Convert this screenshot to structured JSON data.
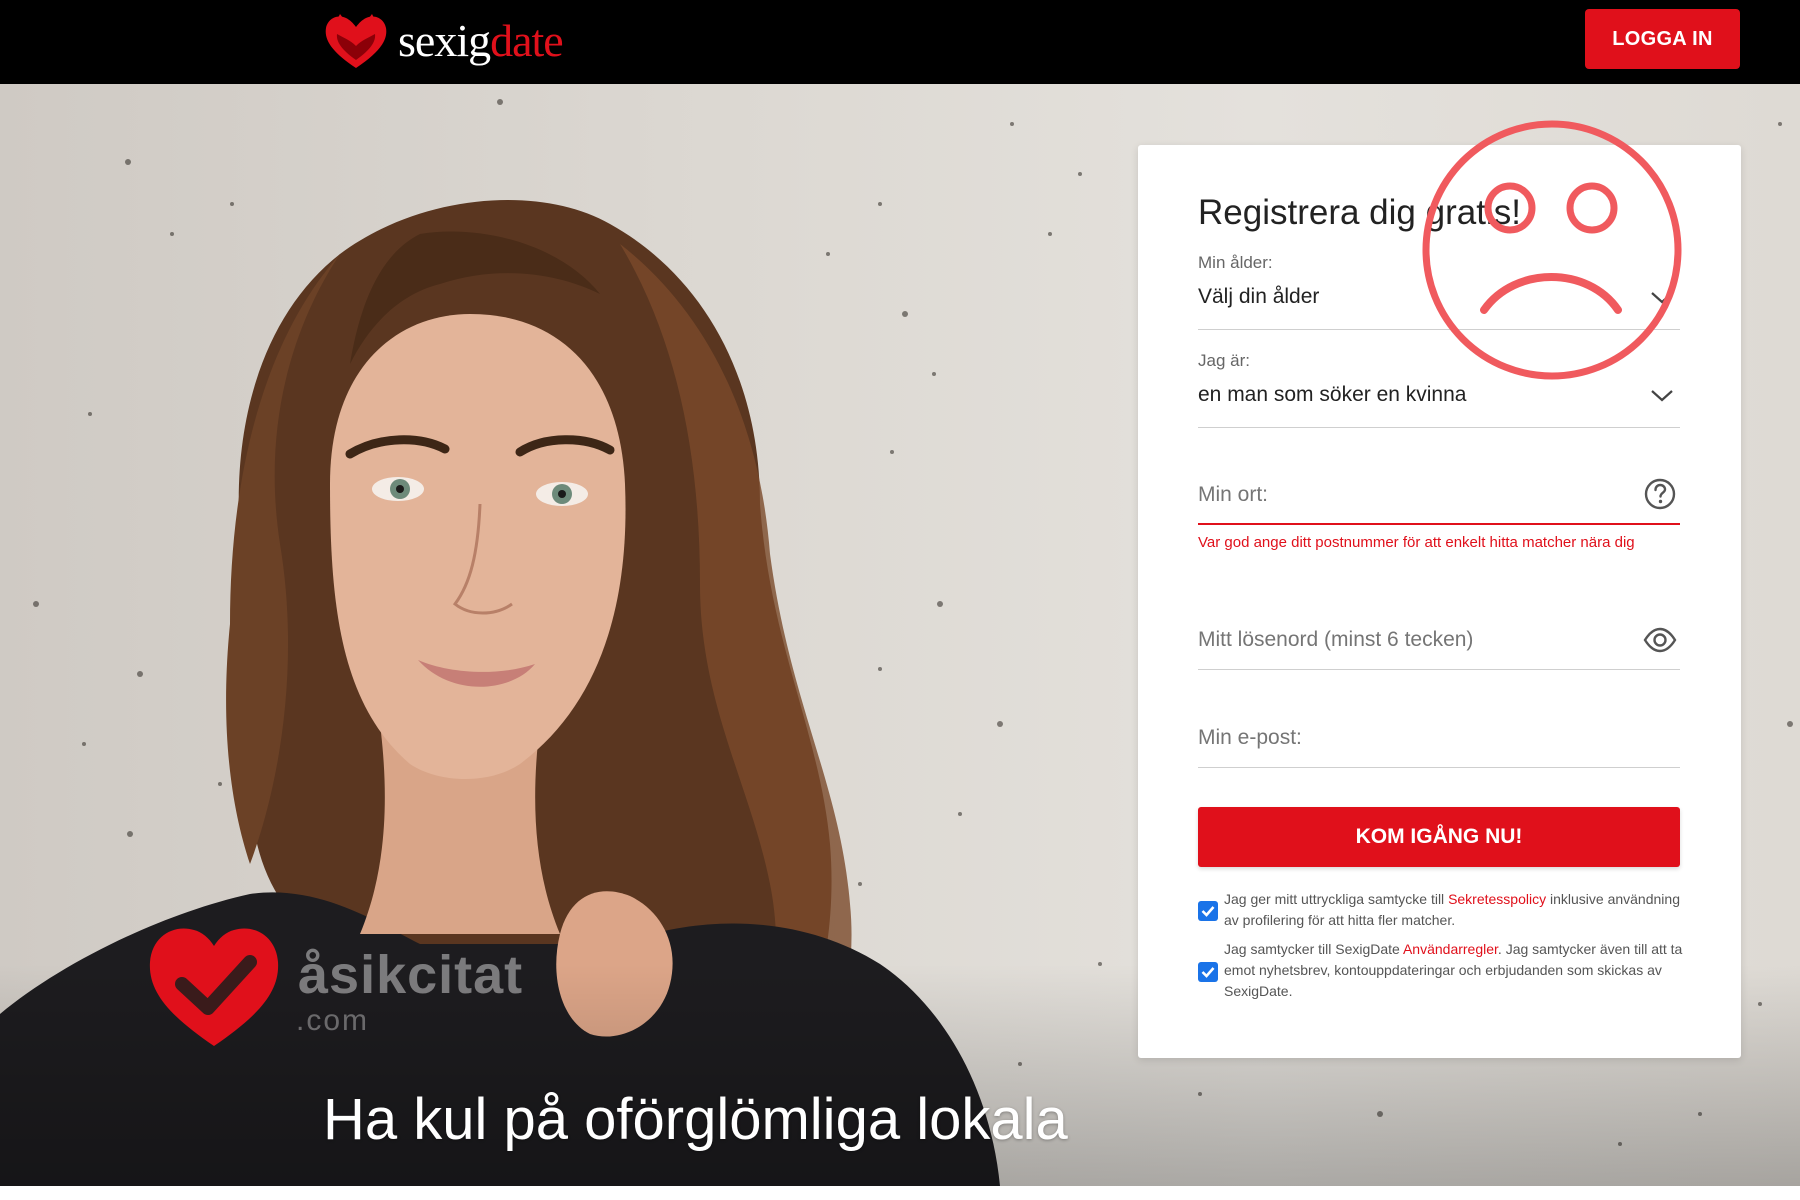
{
  "header": {
    "logo_part1": "sexig",
    "logo_part2": "date",
    "login_label": "LOGGA IN"
  },
  "hero": {
    "headline_line1": "Ha kul på oförglömliga lokala",
    "watermark_text": "åsikcitat",
    "watermark_sub": ".com"
  },
  "form": {
    "title": "Registrera dig gratis!",
    "age": {
      "label": "Min ålder:",
      "value": "Välj din ålder"
    },
    "gender": {
      "label": "Jag är:",
      "value": "en man som söker en kvinna"
    },
    "city": {
      "placeholder": "Min ort:",
      "error": "Var god ange ditt postnummer för att enkelt hitta matcher nära dig"
    },
    "password": {
      "placeholder": "Mitt lösenord (minst 6 tecken)"
    },
    "email": {
      "placeholder": "Min e-post:"
    },
    "submit_label": "KOM IGÅNG NU!",
    "consent1": {
      "checked": true,
      "before": "Jag ger mitt uttryckliga samtycke till ",
      "link": "Sekretesspolicy",
      "after": " inklusive användning av profilering för att hitta fler matcher."
    },
    "consent2": {
      "checked": true,
      "before": "Jag samtycker till SexigDate ",
      "link": "Användarregler",
      "after": ". Jag samtycker även till att ta emot nyhetsbrev, kontouppdateringar och erbjudanden som skickas av SexigDate."
    }
  },
  "colors": {
    "brand_red": "#e0101b",
    "topbar": "#000000",
    "checkbox_blue": "#1a73e8",
    "overlay_face": "#f05a5e"
  },
  "icons": [
    "heart-logo-icon",
    "chevron-down-icon",
    "help-circle-icon",
    "eye-icon",
    "checkbox-checked-icon",
    "sad-face-icon",
    "heart-check-icon"
  ]
}
